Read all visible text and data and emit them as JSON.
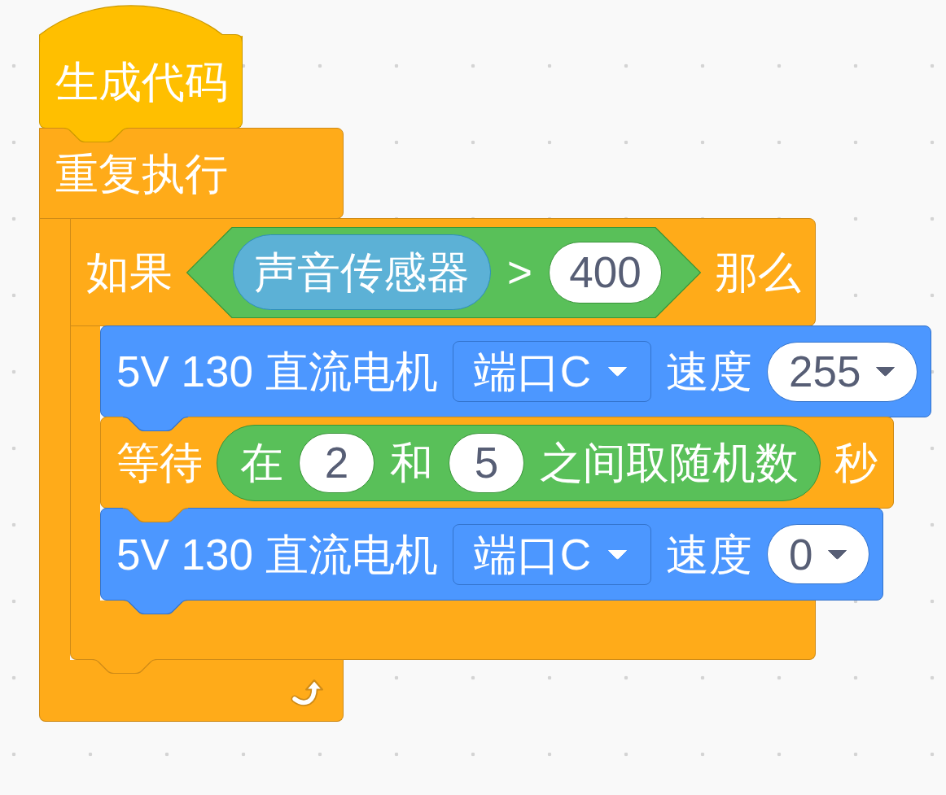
{
  "script": [
    {
      "kind": "hat",
      "label": "生成代码"
    },
    {
      "kind": "forever",
      "label": "重复执行",
      "children": [
        {
          "kind": "if",
          "label": "如果",
          "condition": {
            "reporter": "声音传感器",
            "operator": ">",
            "value": "400"
          },
          "then_label": "那么",
          "children": [
            {
              "kind": "motor",
              "label": "5V 130 直流电机",
              "port": "端口C",
              "speed_label": "速度",
              "speed": "255"
            },
            {
              "kind": "wait",
              "label": "等待",
              "random": {
                "prefix": "在",
                "from": "2",
                "middle": "和",
                "to": "5",
                "suffix": "之间取随机数"
              },
              "unit": "秒"
            },
            {
              "kind": "motor",
              "label": "5V 130 直流电机",
              "port": "端口C",
              "speed_label": "速度",
              "speed": "0"
            }
          ]
        }
      ]
    }
  ]
}
